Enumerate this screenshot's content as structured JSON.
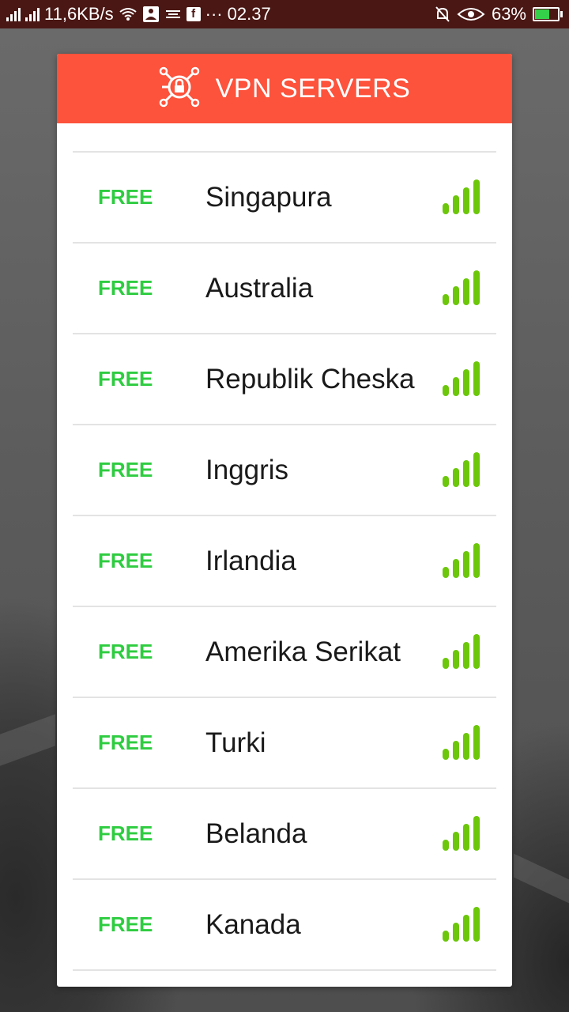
{
  "status_bar": {
    "net_speed": "11,6KB/s",
    "time": "02.37",
    "battery": "63%",
    "battery_level": 0.63,
    "more_indicator": "···",
    "icons": [
      "signal-icon",
      "signal-icon",
      "wifi-icon",
      "meditation-app-icon",
      "zen-icon",
      "facebook-icon",
      "mute-icon",
      "eye-icon",
      "battery-charging-icon"
    ]
  },
  "dialog": {
    "title": "VPN SERVERS",
    "header_icon": "lock-network-icon",
    "colors": {
      "header": "#fd523b",
      "free_label": "#2ecc40",
      "signal_bars": "#6cc70a"
    }
  },
  "servers": [
    {
      "tier": "FREE",
      "country": "Singapura",
      "signal_icon": "signal-strength-icon"
    },
    {
      "tier": "FREE",
      "country": "Australia",
      "signal_icon": "signal-strength-icon"
    },
    {
      "tier": "FREE",
      "country": "Republik Cheska",
      "signal_icon": "signal-strength-icon"
    },
    {
      "tier": "FREE",
      "country": "Inggris",
      "signal_icon": "signal-strength-icon"
    },
    {
      "tier": "FREE",
      "country": "Irlandia",
      "signal_icon": "signal-strength-icon"
    },
    {
      "tier": "FREE",
      "country": "Amerika Serikat",
      "signal_icon": "signal-strength-icon"
    },
    {
      "tier": "FREE",
      "country": "Turki",
      "signal_icon": "signal-strength-icon"
    },
    {
      "tier": "FREE",
      "country": "Belanda",
      "signal_icon": "signal-strength-icon"
    },
    {
      "tier": "FREE",
      "country": "Kanada",
      "signal_icon": "signal-strength-icon"
    }
  ]
}
